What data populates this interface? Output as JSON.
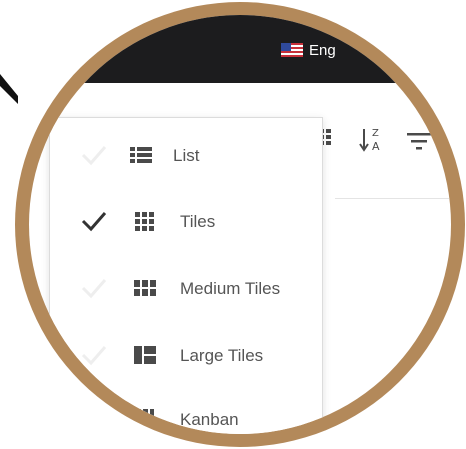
{
  "header": {
    "language_label": "Eng",
    "language_flag_icon": "us-flag-icon"
  },
  "toolbar": {
    "icons": [
      "grid-icon",
      "sort-alpha-icon",
      "filter-icon"
    ],
    "sort_letters": {
      "top": "Z",
      "bottom": "A"
    }
  },
  "view_menu": {
    "items": [
      {
        "label": "List",
        "icon": "list-view-icon",
        "checked": false
      },
      {
        "label": "Tiles",
        "icon": "tiles-view-icon",
        "checked": true
      },
      {
        "label": "Medium Tiles",
        "icon": "medium-tiles-view-icon",
        "checked": false
      },
      {
        "label": "Large Tiles",
        "icon": "large-tiles-view-icon",
        "checked": false
      },
      {
        "label": "Kanban",
        "icon": "kanban-view-icon",
        "checked": false
      }
    ]
  },
  "colors": {
    "lens_border": "#b3895a",
    "header_bg": "#1c1c1e",
    "icon_gray": "#4a4a4a",
    "check_active": "#333333",
    "check_faded": "#eeeeee"
  }
}
